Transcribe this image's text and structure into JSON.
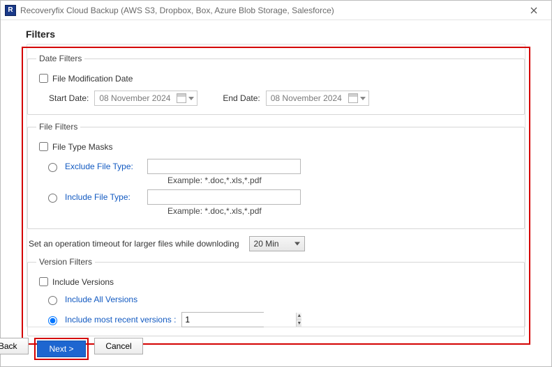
{
  "window": {
    "title": "Recoveryfix Cloud Backup (AWS S3, Dropbox, Box, Azure Blob Storage, Salesforce)",
    "icon_letter": "R"
  },
  "page": {
    "title": "Filters"
  },
  "date_filters": {
    "legend": "Date Filters",
    "file_mod_label": "File Modification Date",
    "file_mod_checked": false,
    "start_label": "Start Date:",
    "start_value": "08 November 2024",
    "end_label": "End Date:",
    "end_value": "08 November 2024"
  },
  "file_filters": {
    "legend": "File Filters",
    "masks_label": "File Type Masks",
    "masks_checked": false,
    "exclude_label": "Exclude File Type:",
    "exclude_value": "",
    "exclude_example": "Example:  *.doc,*.xls,*.pdf",
    "include_label": "Include File Type:",
    "include_value": "",
    "include_example": "Example:  *.doc,*.xls,*.pdf"
  },
  "timeout": {
    "label": "Set an operation timeout for larger files while downloding",
    "value": "20 Min"
  },
  "version_filters": {
    "legend": "Version Filters",
    "include_versions_label": "Include Versions",
    "include_versions_checked": false,
    "all_label": "Include All Versions",
    "recent_label": "Include most recent versions :",
    "recent_selected": true,
    "recent_value": "1"
  },
  "footer": {
    "back": "< Back",
    "next": "Next >",
    "cancel": "Cancel"
  }
}
